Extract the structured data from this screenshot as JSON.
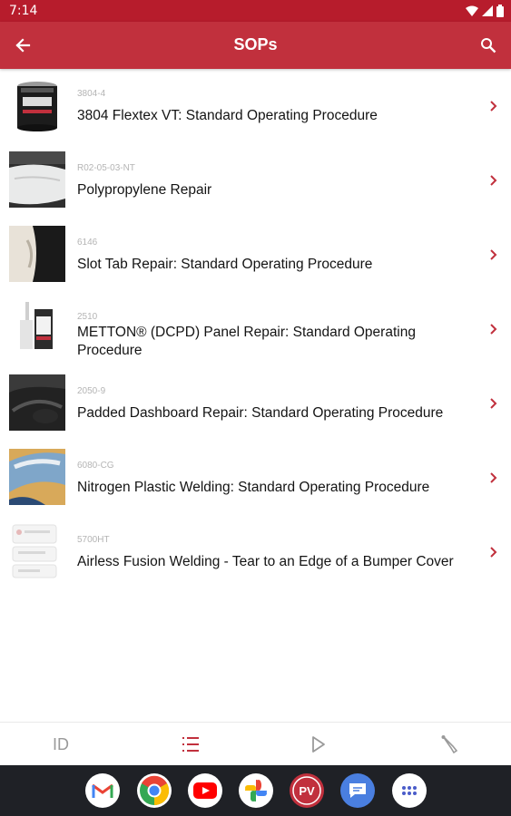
{
  "status_bar": {
    "time": "7:14"
  },
  "app_bar": {
    "title": "SOPs"
  },
  "items": [
    {
      "code": "3804-4",
      "title": "3804 Flextex VT: Standard Operating Procedure"
    },
    {
      "code": "R02-05-03-NT",
      "title": "Polypropylene Repair"
    },
    {
      "code": "6146",
      "title": "Slot Tab Repair:  Standard Operating Procedure"
    },
    {
      "code": "2510",
      "title": "METTON® (DCPD) Panel Repair: Standard Operating Procedure"
    },
    {
      "code": "2050-9",
      "title": "Padded Dashboard Repair: Standard Operating Procedure"
    },
    {
      "code": "6080-CG",
      "title": "Nitrogen Plastic Welding: Standard Operating Procedure"
    },
    {
      "code": "5700HT",
      "title": "Airless Fusion Welding - Tear to an Edge of a Bumper Cover"
    }
  ],
  "bottom_nav": {
    "id_label": "ID",
    "items": [
      "id",
      "list-icon",
      "play-icon",
      "tool-icon"
    ],
    "active": "list-icon"
  },
  "dock": {
    "apps": [
      "gmail-icon",
      "chrome-icon",
      "youtube-icon",
      "photos-icon",
      "pv-app-icon",
      "messages-icon",
      "app-drawer-icon"
    ],
    "pv_label": "PV"
  },
  "colors": {
    "app_bar": "#c1303d",
    "status_bar": "#b71c2c",
    "accent": "#c1303d",
    "dock": "#1f2126"
  }
}
